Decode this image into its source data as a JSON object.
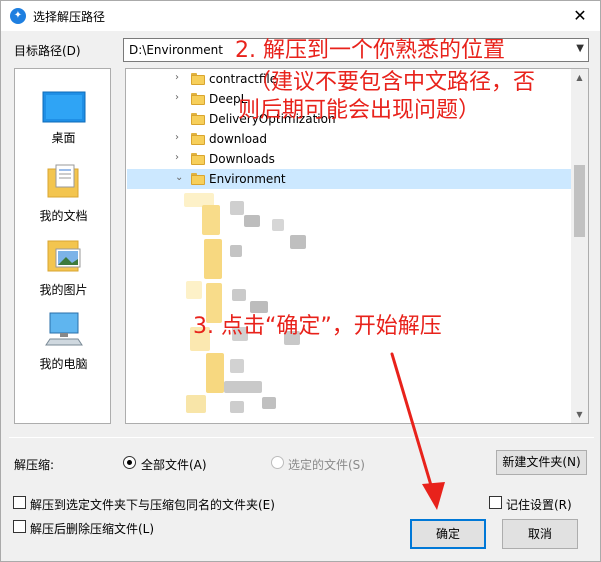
{
  "window": {
    "title": "选择解压路径",
    "close_glyph": "✕"
  },
  "path": {
    "label": "目标路径(D)",
    "value": "D:\\Environment"
  },
  "places": [
    {
      "label": "桌面",
      "icon": "desktop-icon"
    },
    {
      "label": "我的文档",
      "icon": "documents-icon"
    },
    {
      "label": "我的图片",
      "icon": "pictures-icon"
    },
    {
      "label": "我的电脑",
      "icon": "computer-icon"
    }
  ],
  "tree": {
    "items": [
      {
        "label": "contractfile",
        "expanded": false,
        "selected": false
      },
      {
        "label": "DeepL",
        "expanded": false,
        "selected": false
      },
      {
        "label": "DeliveryOptimization",
        "expanded": false,
        "selected": false
      },
      {
        "label": "download",
        "expanded": false,
        "selected": false
      },
      {
        "label": "Downloads",
        "expanded": false,
        "selected": false
      },
      {
        "label": "Environment",
        "expanded": true,
        "selected": true
      }
    ]
  },
  "extract": {
    "label": "解压缩:",
    "option_all": "全部文件(A)",
    "option_selected": "选定的文件(S)",
    "selected_option": "全部文件(A)",
    "new_folder_button": "新建文件夹(N)"
  },
  "checkboxes": {
    "same_name_folder": "解压到选定文件夹下与压缩包同名的文件夹(E)",
    "delete_after": "解压后删除压缩文件(L)",
    "remember": "记住设置(R)"
  },
  "buttons": {
    "ok": "确定",
    "cancel": "取消"
  },
  "annotations": {
    "step2_line1": "2. 解压到一个你熟悉的位置",
    "step2_line2": "（建议不要包含中文路径，否",
    "step2_line3": "则后期可能会出现问题）",
    "step3": "3. 点击“确定”，开始解压"
  },
  "colors": {
    "annotation": "#e8221b",
    "selection": "#cce8ff",
    "accent": "#0078d7",
    "folder": "#f7cf5a"
  }
}
